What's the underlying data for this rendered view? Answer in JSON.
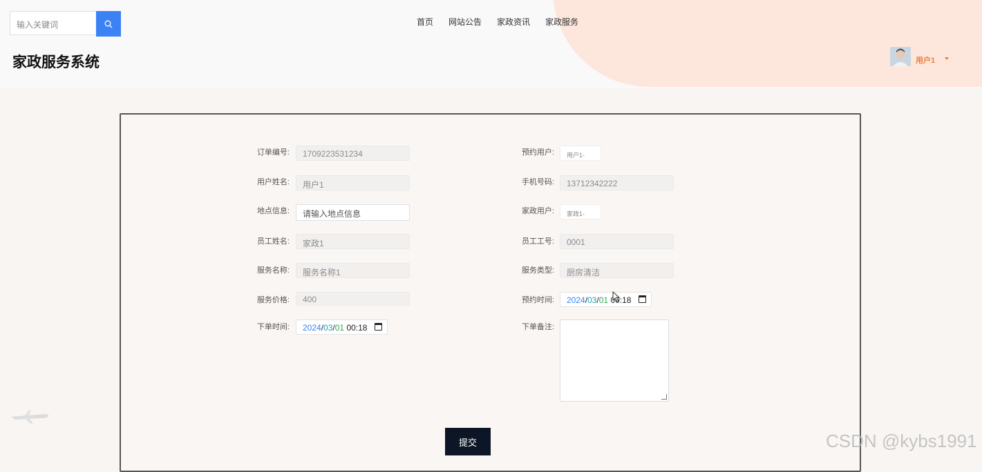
{
  "header": {
    "search_placeholder": "输入关键词",
    "site_title": "家政服务系统",
    "nav": [
      "首页",
      "网站公告",
      "家政资讯",
      "家政服务"
    ],
    "user_name": "用户1"
  },
  "form": {
    "order_no": {
      "label": "订单编号:",
      "value": "1709223531234"
    },
    "booking_user": {
      "label": "预约用户:",
      "value": "用户1-"
    },
    "user_name": {
      "label": "用户姓名:",
      "value": "用户1"
    },
    "phone": {
      "label": "手机号码:",
      "value": "13712342222"
    },
    "location": {
      "label": "地点信息:",
      "placeholder": "请输入地点信息"
    },
    "housekeeper_user": {
      "label": "家政用户:",
      "value": "家政1-"
    },
    "staff_name": {
      "label": "员工姓名:",
      "value": "家政1"
    },
    "staff_no": {
      "label": "员工工号:",
      "value": "0001"
    },
    "service_name": {
      "label": "服务名称:",
      "value": "服务名称1"
    },
    "service_type": {
      "label": "服务类型:",
      "value": "厨房清洁"
    },
    "service_price": {
      "label": "服务价格:",
      "value": "400"
    },
    "booking_time": {
      "label": "预约时间:",
      "year": "2024",
      "month": "03",
      "day": "01",
      "time": "00:18"
    },
    "order_time": {
      "label": "下单时间:",
      "year": "2024",
      "month": "03",
      "day": "01",
      "time": "00:18"
    },
    "remark": {
      "label": "下单备注:"
    },
    "submit_label": "提交"
  },
  "watermark": "CSDN @kybs1991",
  "colors": {
    "accent": "#3b82f6",
    "user": "#ef7b39",
    "submit": "#0c1626"
  }
}
